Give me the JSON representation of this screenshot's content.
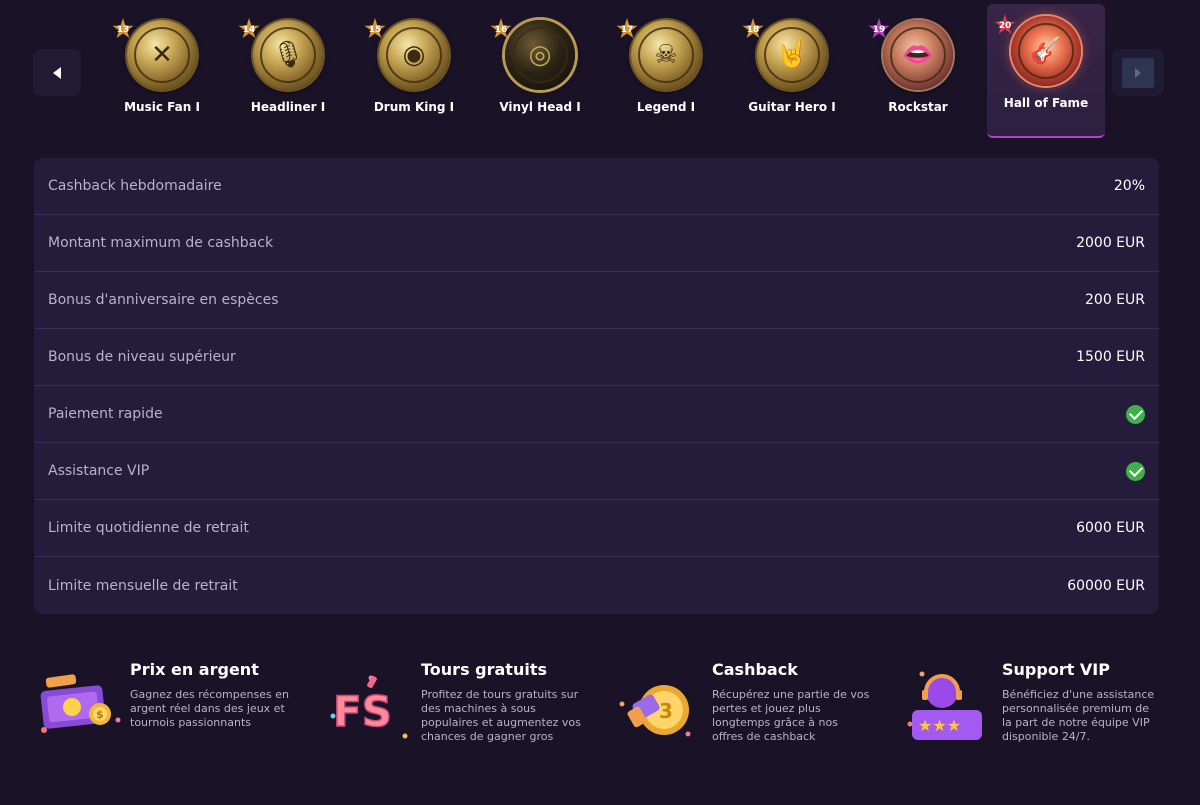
{
  "carousel": {
    "levels": [
      {
        "number": "13",
        "name": "Music Fan I",
        "icon": "crossed-drumsticks-icon",
        "glyph": "✕",
        "style": "gold",
        "badge_color": "#d9962a"
      },
      {
        "number": "14",
        "name": "Headliner I",
        "icon": "microphone-icon",
        "glyph": "🎙",
        "style": "gold",
        "badge_color": "#d9962a"
      },
      {
        "number": "15",
        "name": "Drum King I",
        "icon": "drum-icon",
        "glyph": "◉",
        "style": "gold",
        "badge_color": "#d9962a"
      },
      {
        "number": "16",
        "name": "Vinyl Head I",
        "icon": "vinyl-record-icon",
        "glyph": "◎",
        "style": "dark",
        "badge_color": "#d9962a"
      },
      {
        "number": "17",
        "name": "Legend I",
        "icon": "skull-icon",
        "glyph": "☠",
        "style": "gold",
        "badge_color": "#d9962a"
      },
      {
        "number": "18",
        "name": "Guitar Hero I",
        "icon": "rock-hand-icon",
        "glyph": "🤘",
        "style": "gold",
        "badge_color": "#d9962a"
      },
      {
        "number": "19",
        "name": "Rockstar",
        "icon": "lips-icon",
        "glyph": "👄",
        "style": "pink",
        "badge_color": "#b63fbf"
      },
      {
        "number": "20",
        "name": "Hall of Fame",
        "icon": "flaming-guitar-icon",
        "glyph": "🎸",
        "style": "fire",
        "badge_color": "#d23a4a",
        "active": true
      }
    ]
  },
  "benefits": [
    {
      "label": "Cashback hebdomadaire",
      "value": "20%"
    },
    {
      "label": "Montant maximum de cashback",
      "value": "2000 EUR"
    },
    {
      "label": "Bonus d'anniversaire en espèces",
      "value": "200 EUR"
    },
    {
      "label": "Bonus de niveau supérieur",
      "value": "1500 EUR"
    },
    {
      "label": "Paiement rapide",
      "value": "",
      "check": true
    },
    {
      "label": "Assistance VIP",
      "value": "",
      "check": true
    },
    {
      "label": "Limite quotidienne de retrait",
      "value": "6000 EUR"
    },
    {
      "label": "Limite mensuelle de retrait",
      "value": "60000 EUR"
    }
  ],
  "features": [
    {
      "title": "Prix en argent",
      "desc": "Gagnez des récompenses en argent réel dans des jeux et tournois passionnants",
      "icon": "cash-prize-icon"
    },
    {
      "title": "Tours gratuits",
      "desc": "Profitez de tours gratuits sur des machines à sous populaires et augmentez vos chances de gagner gros",
      "icon": "free-spins-icon"
    },
    {
      "title": "Cashback",
      "desc": "Récupérez une partie de vos pertes et jouez plus longtemps grâce à nos offres de cashback",
      "icon": "cashback-coin-icon"
    },
    {
      "title": "Support VIP",
      "desc": "Bénéficiez d'une assistance personnalisée premium de la part de notre équipe VIP disponible 24/7.",
      "icon": "vip-support-icon"
    }
  ],
  "feature_glyph_fs": "FS",
  "feature_glyph_coin": "3",
  "colors": {
    "accent": "#c13ad0",
    "check": "#3fb04a",
    "background": "#1a1328",
    "panel": "#251b3b"
  }
}
